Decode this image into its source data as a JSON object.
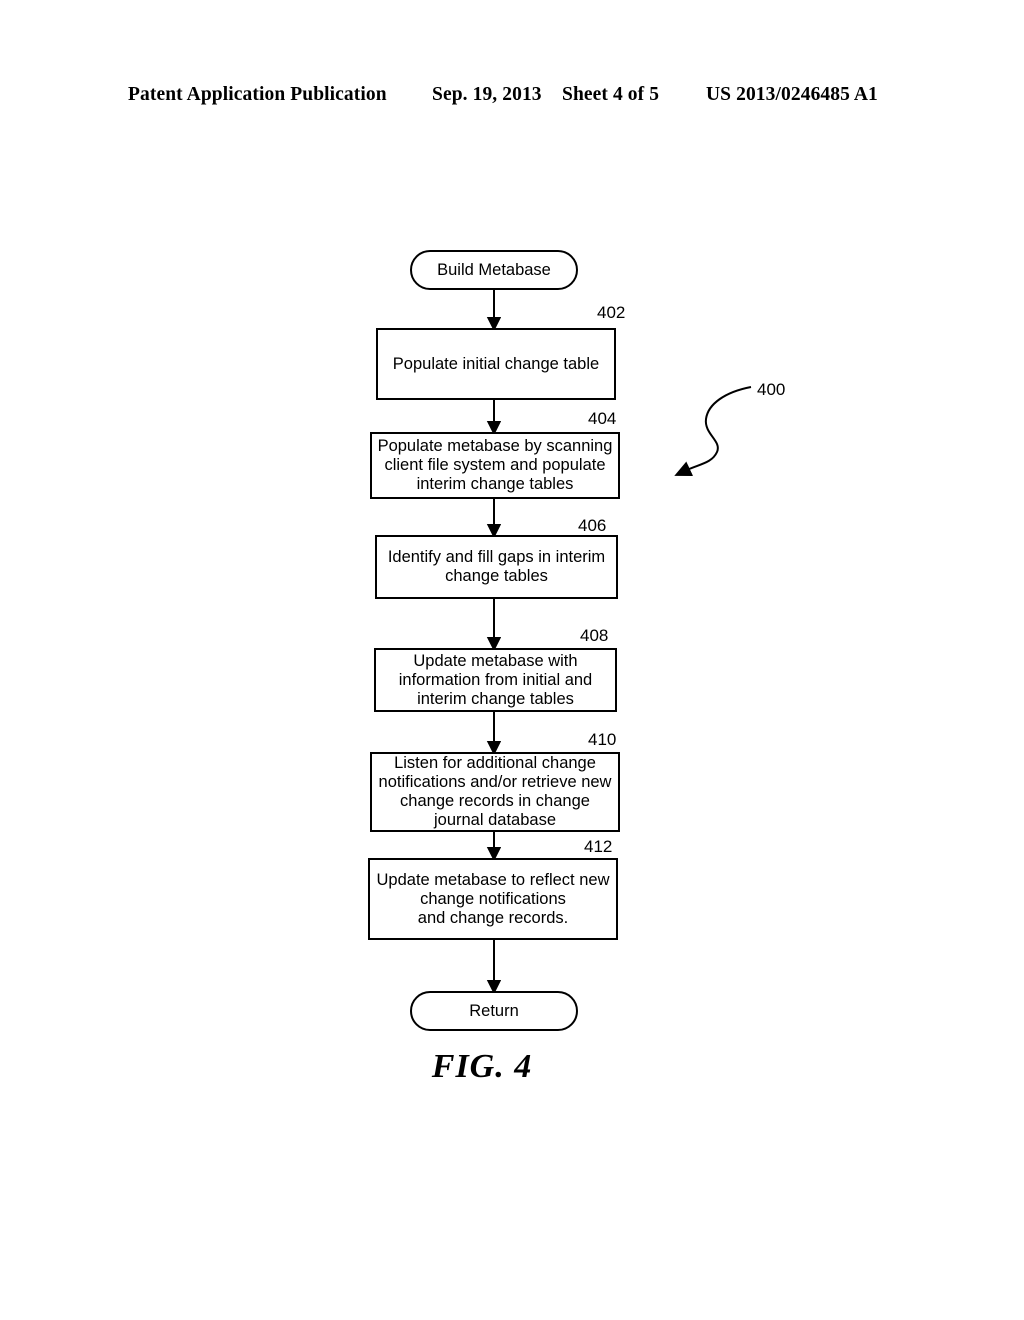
{
  "header": {
    "publication": "Patent Application Publication",
    "date": "Sep. 19, 2013",
    "sheet": "Sheet 4 of 5",
    "patent_number": "US 2013/0246485 A1"
  },
  "figure": {
    "caption": "FIG. 4",
    "overall_ref": "400",
    "nodes": [
      {
        "id": "start",
        "shape": "terminator",
        "label": "Build Metabase",
        "ref": ""
      },
      {
        "id": "402",
        "shape": "process",
        "label": "Populate initial change table",
        "ref": "402"
      },
      {
        "id": "404",
        "shape": "process",
        "label": "Populate metabase by scanning\nclient file system and populate\ninterim change tables",
        "ref": "404"
      },
      {
        "id": "406",
        "shape": "process",
        "label": "Identify and fill gaps in interim\nchange tables",
        "ref": "406"
      },
      {
        "id": "408",
        "shape": "process",
        "label": "Update metabase with\ninformation from initial and\ninterim change tables",
        "ref": "408"
      },
      {
        "id": "410",
        "shape": "process",
        "label": "Listen for additional change\nnotifications and/or retrieve new\nchange records in change\njournal database",
        "ref": "410"
      },
      {
        "id": "412",
        "shape": "process",
        "label": "Update metabase to reflect new\nchange notifications\nand change records.",
        "ref": "412"
      },
      {
        "id": "return",
        "shape": "terminator",
        "label": "Return",
        "ref": ""
      }
    ]
  },
  "colors": {
    "ink": "#000000",
    "paper": "#ffffff"
  }
}
